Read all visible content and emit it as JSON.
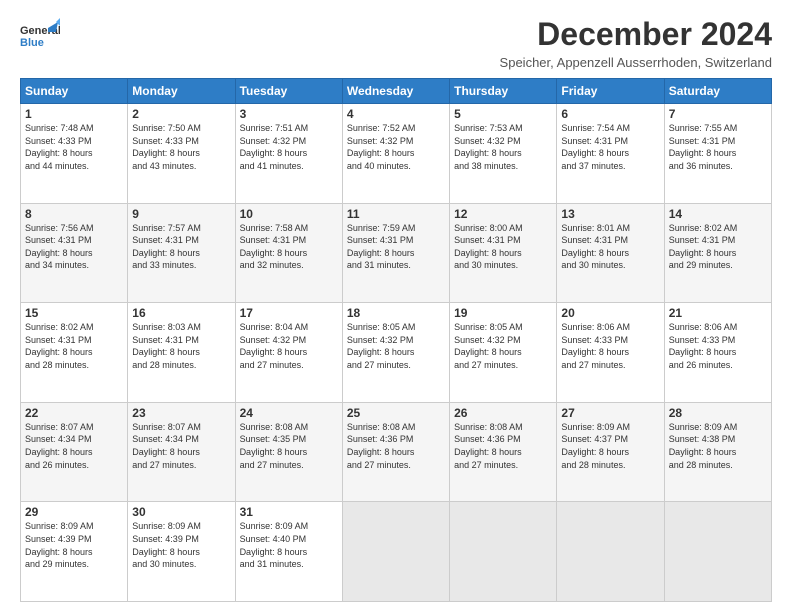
{
  "header": {
    "logo_general": "General",
    "logo_blue": "Blue",
    "title": "December 2024",
    "subtitle": "Speicher, Appenzell Ausserrhoden, Switzerland"
  },
  "days_of_week": [
    "Sunday",
    "Monday",
    "Tuesday",
    "Wednesday",
    "Thursday",
    "Friday",
    "Saturday"
  ],
  "weeks": [
    [
      {
        "day": "1",
        "sunrise": "7:48 AM",
        "sunset": "4:33 PM",
        "daylight": "8 hours and 44 minutes."
      },
      {
        "day": "2",
        "sunrise": "7:50 AM",
        "sunset": "4:33 PM",
        "daylight": "8 hours and 43 minutes."
      },
      {
        "day": "3",
        "sunrise": "7:51 AM",
        "sunset": "4:32 PM",
        "daylight": "8 hours and 41 minutes."
      },
      {
        "day": "4",
        "sunrise": "7:52 AM",
        "sunset": "4:32 PM",
        "daylight": "8 hours and 40 minutes."
      },
      {
        "day": "5",
        "sunrise": "7:53 AM",
        "sunset": "4:32 PM",
        "daylight": "8 hours and 38 minutes."
      },
      {
        "day": "6",
        "sunrise": "7:54 AM",
        "sunset": "4:31 PM",
        "daylight": "8 hours and 37 minutes."
      },
      {
        "day": "7",
        "sunrise": "7:55 AM",
        "sunset": "4:31 PM",
        "daylight": "8 hours and 36 minutes."
      }
    ],
    [
      {
        "day": "8",
        "sunrise": "7:56 AM",
        "sunset": "4:31 PM",
        "daylight": "8 hours and 34 minutes."
      },
      {
        "day": "9",
        "sunrise": "7:57 AM",
        "sunset": "4:31 PM",
        "daylight": "8 hours and 33 minutes."
      },
      {
        "day": "10",
        "sunrise": "7:58 AM",
        "sunset": "4:31 PM",
        "daylight": "8 hours and 32 minutes."
      },
      {
        "day": "11",
        "sunrise": "7:59 AM",
        "sunset": "4:31 PM",
        "daylight": "8 hours and 31 minutes."
      },
      {
        "day": "12",
        "sunrise": "8:00 AM",
        "sunset": "4:31 PM",
        "daylight": "8 hours and 30 minutes."
      },
      {
        "day": "13",
        "sunrise": "8:01 AM",
        "sunset": "4:31 PM",
        "daylight": "8 hours and 30 minutes."
      },
      {
        "day": "14",
        "sunrise": "8:02 AM",
        "sunset": "4:31 PM",
        "daylight": "8 hours and 29 minutes."
      }
    ],
    [
      {
        "day": "15",
        "sunrise": "8:02 AM",
        "sunset": "4:31 PM",
        "daylight": "8 hours and 28 minutes."
      },
      {
        "day": "16",
        "sunrise": "8:03 AM",
        "sunset": "4:31 PM",
        "daylight": "8 hours and 28 minutes."
      },
      {
        "day": "17",
        "sunrise": "8:04 AM",
        "sunset": "4:32 PM",
        "daylight": "8 hours and 27 minutes."
      },
      {
        "day": "18",
        "sunrise": "8:05 AM",
        "sunset": "4:32 PM",
        "daylight": "8 hours and 27 minutes."
      },
      {
        "day": "19",
        "sunrise": "8:05 AM",
        "sunset": "4:32 PM",
        "daylight": "8 hours and 27 minutes."
      },
      {
        "day": "20",
        "sunrise": "8:06 AM",
        "sunset": "4:33 PM",
        "daylight": "8 hours and 27 minutes."
      },
      {
        "day": "21",
        "sunrise": "8:06 AM",
        "sunset": "4:33 PM",
        "daylight": "8 hours and 26 minutes."
      }
    ],
    [
      {
        "day": "22",
        "sunrise": "8:07 AM",
        "sunset": "4:34 PM",
        "daylight": "8 hours and 26 minutes."
      },
      {
        "day": "23",
        "sunrise": "8:07 AM",
        "sunset": "4:34 PM",
        "daylight": "8 hours and 27 minutes."
      },
      {
        "day": "24",
        "sunrise": "8:08 AM",
        "sunset": "4:35 PM",
        "daylight": "8 hours and 27 minutes."
      },
      {
        "day": "25",
        "sunrise": "8:08 AM",
        "sunset": "4:36 PM",
        "daylight": "8 hours and 27 minutes."
      },
      {
        "day": "26",
        "sunrise": "8:08 AM",
        "sunset": "4:36 PM",
        "daylight": "8 hours and 27 minutes."
      },
      {
        "day": "27",
        "sunrise": "8:09 AM",
        "sunset": "4:37 PM",
        "daylight": "8 hours and 28 minutes."
      },
      {
        "day": "28",
        "sunrise": "8:09 AM",
        "sunset": "4:38 PM",
        "daylight": "8 hours and 28 minutes."
      }
    ],
    [
      {
        "day": "29",
        "sunrise": "8:09 AM",
        "sunset": "4:39 PM",
        "daylight": "8 hours and 29 minutes."
      },
      {
        "day": "30",
        "sunrise": "8:09 AM",
        "sunset": "4:39 PM",
        "daylight": "8 hours and 30 minutes."
      },
      {
        "day": "31",
        "sunrise": "8:09 AM",
        "sunset": "4:40 PM",
        "daylight": "8 hours and 31 minutes."
      },
      null,
      null,
      null,
      null
    ]
  ]
}
